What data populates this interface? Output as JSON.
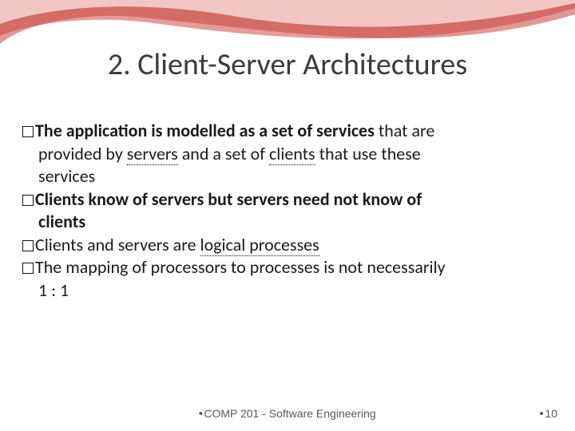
{
  "title": "2. Client-Server Architectures",
  "bullets": {
    "b1_bold": "The application is modelled as a set of services",
    "b1_rest1": " that are",
    "b1_rest2": "provided by ",
    "b1_u1": "servers",
    "b1_rest3": " and a set of ",
    "b1_u2": "clients",
    "b1_rest4": " that use these",
    "b1_rest5": "services",
    "b2_bold1": "Clients know of servers but servers need not know of",
    "b2_bold2": "clients",
    "b3_plain": "Clients and servers are ",
    "b3_u": "logical processes",
    "b4_line1": "The mapping of processors to processes is not necessarily",
    "b4_line2": "1 : 1"
  },
  "footer": {
    "course": "COMP 201 - Software Engineering",
    "page": "10"
  }
}
